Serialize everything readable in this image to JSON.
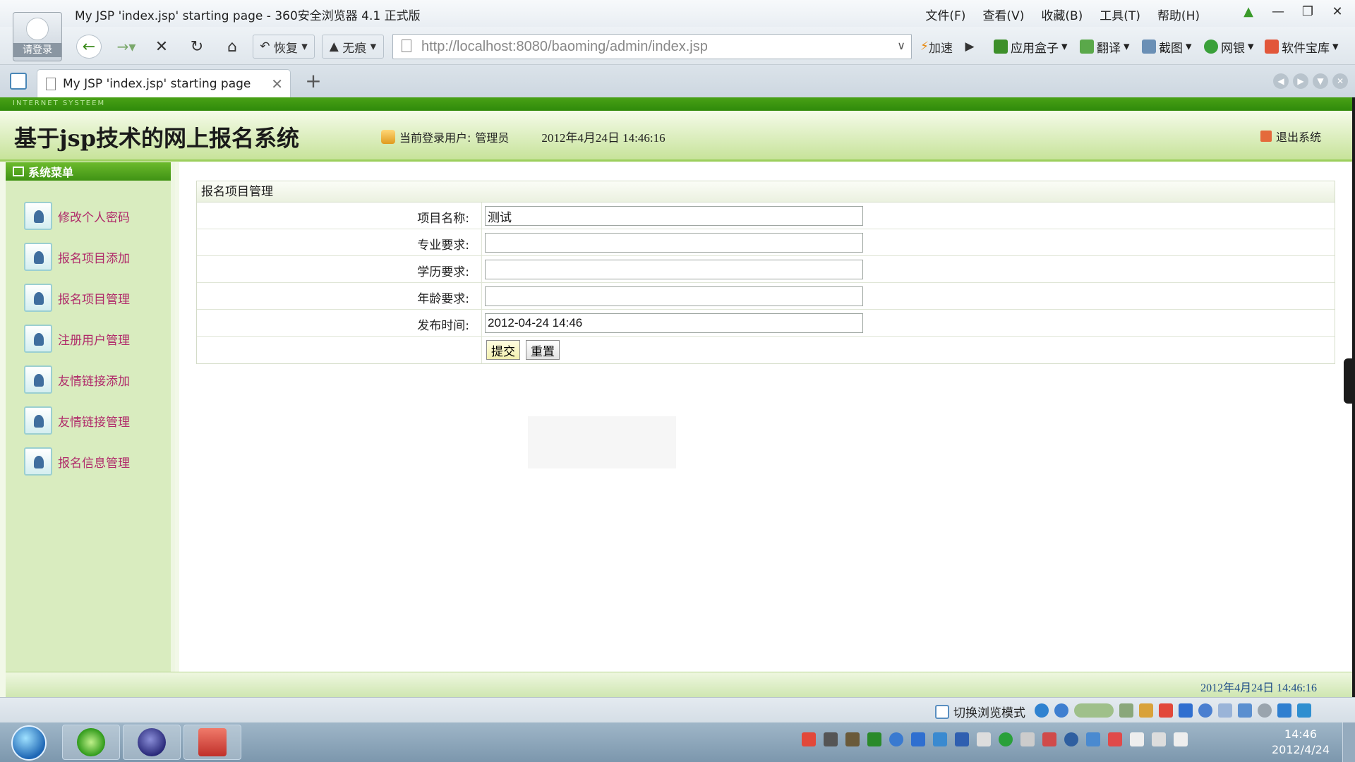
{
  "window": {
    "title": "My JSP 'index.jsp' starting page - 360安全浏览器 4.1 正式版",
    "avatar_label": "请登录",
    "menus": [
      "文件(F)",
      "查看(V)",
      "收藏(B)",
      "工具(T)",
      "帮助(H)"
    ]
  },
  "toolbar": {
    "restore_label": "恢复",
    "incognito_label": "无痕",
    "url": "http://localhost:8080/baoming/admin/index.jsp",
    "speed_label": "加速",
    "right_tools": [
      "应用盒子",
      "翻译",
      "截图",
      "网银",
      "软件宝库"
    ]
  },
  "tabs": {
    "active_title": "My JSP 'index.jsp' starting page"
  },
  "app": {
    "strip_text": "INTERNET SYSTEEM",
    "title": "基于jsp技术的网上报名系统",
    "current_user_label": "当前登录用户:",
    "current_user": "管理员",
    "datetime": "2012年4月24日  14:46:16",
    "logout_label": "退出系统",
    "menu_title": "系统菜单",
    "menu_items": [
      "修改个人密码",
      "报名项目添加",
      "报名项目管理",
      "注册用户管理",
      "友情链接添加",
      "友情链接管理",
      "报名信息管理"
    ],
    "panel_title": "报名项目管理",
    "form": {
      "name_label": "项目名称:",
      "name_value": "测试",
      "major_label": "专业要求:",
      "major_value": "",
      "education_label": "学历要求:",
      "education_value": "",
      "age_label": "年龄要求:",
      "age_value": "",
      "publish_label": "发布时间:",
      "publish_value": "2012-04-24 14:46",
      "submit_label": "提交",
      "reset_label": "重置"
    },
    "footer_datetime": "2012年4月24日  14:46:16"
  },
  "statusbar": {
    "mode_switch_label": "切换浏览模式"
  },
  "taskbar": {
    "clock_time": "14:46",
    "clock_date": "2012/4/24"
  },
  "colors": {
    "header_green": "#3f9214",
    "menu_bg": "#d9ecbf",
    "menu_text": "#b02a6a",
    "footer_date": "#1f4d88"
  }
}
